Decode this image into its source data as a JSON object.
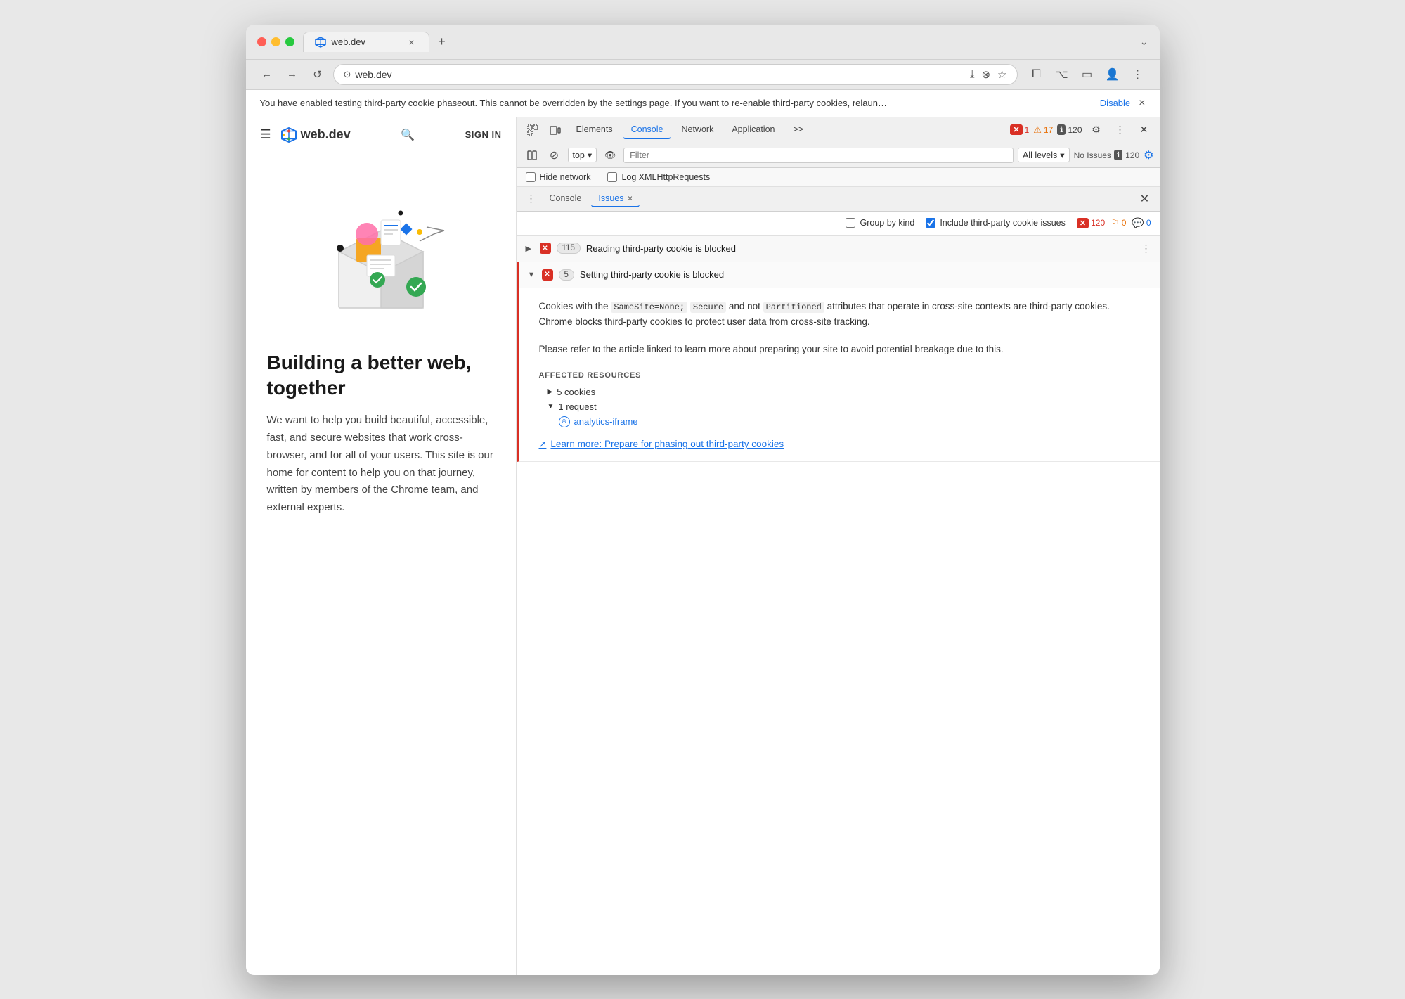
{
  "browser": {
    "tab_title": "web.dev",
    "tab_favicon": "◈",
    "tab_close": "×",
    "new_tab": "+",
    "chevron": "⌄",
    "address": "web.dev",
    "nav_back": "←",
    "nav_forward": "→",
    "nav_refresh": "↺"
  },
  "notification_bar": {
    "text": "You have enabled testing third-party cookie phaseout. This cannot be overridden by the settings page. If you want to re-enable third-party cookies, relaun…",
    "link": "Disable",
    "close": "×"
  },
  "website": {
    "sign_in": "SIGN IN",
    "logo_text": "web.dev",
    "headline": "Building a better web, together",
    "description": "We want to help you build beautiful, accessible, fast, and secure websites that work cross-browser, and for all of your users. This site is our home for content to help you on that journey, written by members of the Chrome team, and external experts."
  },
  "devtools": {
    "tabs": [
      "Elements",
      "Console",
      "Network",
      "Application"
    ],
    "active_tab": "Console",
    "more_tabs": ">>",
    "error_count": "1",
    "warning_count": "17",
    "info_count": "120",
    "toolbar_items": [
      "select-element",
      "device-toggle",
      "settings",
      "more",
      "close"
    ],
    "console_bar": {
      "sidebar_toggle": "☰",
      "clear": "⊘",
      "top_label": "top",
      "eye_label": "👁",
      "filter_placeholder": "Filter",
      "levels_label": "All levels",
      "no_issues_label": "No Issues",
      "no_issues_count": "120"
    },
    "checkboxes": {
      "hide_network": "Hide network",
      "log_xml": "Log XMLHttpRequests"
    },
    "issues_tab_bar": {
      "console_label": "Console",
      "issues_label": "Issues",
      "close": "×"
    },
    "issues_controls": {
      "group_by_kind": "Group by kind",
      "include_third_party": "Include third-party cookie issues",
      "count_120": "120",
      "count_0_orange": "0",
      "count_0_blue": "0"
    },
    "issues": [
      {
        "id": 1,
        "expanded": false,
        "icon": "✕",
        "count": "115",
        "title": "Reading third-party cookie is blocked",
        "has_more": true
      },
      {
        "id": 2,
        "expanded": true,
        "icon": "✕",
        "count": "5",
        "title": "Setting third-party cookie is blocked",
        "description_part1": "Cookies with the",
        "code1": "SameSite=None;",
        "description_part2": "Secure",
        "code2": "and not",
        "code3": "Partitioned",
        "description_part3": "attributes that operate in cross-site contexts are third-party cookies. Chrome blocks third-party cookies to protect user data from cross-site tracking.",
        "followup": "Please refer to the article linked to learn more about preparing your site to avoid potential breakage due to this.",
        "affected_label": "AFFECTED RESOURCES",
        "cookies_label": "5 cookies",
        "request_label": "1 request",
        "request_link": "analytics-iframe",
        "learn_more_text": "Learn more: Prepare for phasing out third-party cookies"
      }
    ]
  }
}
